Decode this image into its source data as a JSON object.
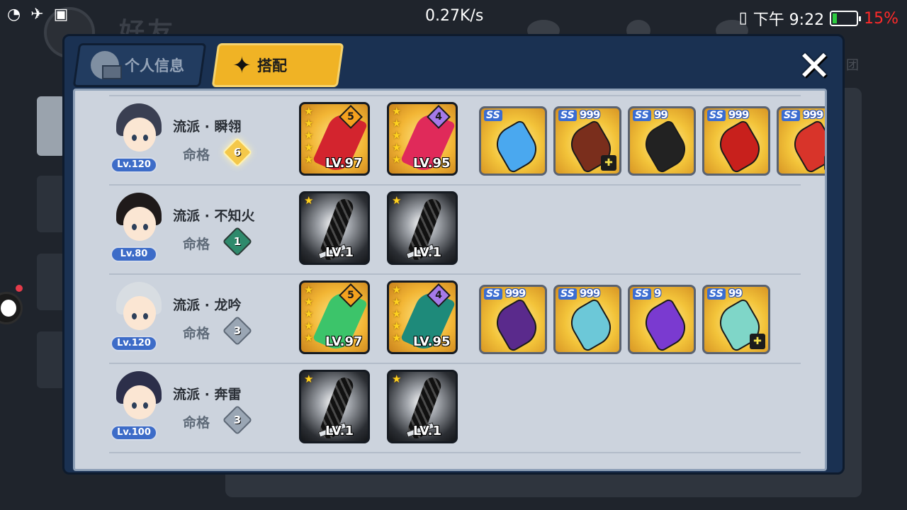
{
  "status_bar": {
    "net_speed": "0.27K/s",
    "time": "下午 9:22",
    "battery_pct": "15%",
    "battery_color": "#ff2a2a"
  },
  "background": {
    "title": "好友",
    "tag": "团"
  },
  "tabs": [
    {
      "label": "个人信息",
      "icon": "person-card-icon",
      "active": false
    },
    {
      "label": "搭配",
      "icon": "shuriken-icon",
      "active": true
    }
  ],
  "fate_label": "命格",
  "rows": [
    {
      "level": "Lv.120",
      "style": "流派 · 瞬翎",
      "fate": "6",
      "fate_style": "gold",
      "hair_color": "#3a3f52",
      "cards": [
        {
          "type": "gold",
          "stars": 5,
          "grade": "5",
          "grade_color": "orange",
          "lv": "LV.97",
          "art_color": "#d3242e"
        },
        {
          "type": "gold",
          "stars": 5,
          "grade": "4",
          "grade_color": "purple",
          "lv": "LV.95",
          "art_color": "#e02a5a"
        }
      ],
      "items": [
        {
          "rank": "SS",
          "marks": "",
          "art_color": "#4aa8ef",
          "corner": false
        },
        {
          "rank": "SS",
          "marks": "999",
          "art_color": "#7a2e1c",
          "corner": true
        },
        {
          "rank": "SS",
          "marks": "99",
          "art_color": "#222222",
          "corner": false
        },
        {
          "rank": "SS",
          "marks": "999",
          "art_color": "#c8201c",
          "corner": false
        },
        {
          "rank": "SS",
          "marks": "999",
          "art_color": "#d8342a",
          "corner": true
        }
      ]
    },
    {
      "level": "Lv.80",
      "style": "流派 · 不知火",
      "fate": "1",
      "fate_style": "teal",
      "hair_color": "#1f1a1a",
      "cards": [
        {
          "type": "dark",
          "stars": 1,
          "grade": "",
          "grade_color": "",
          "lv": "LV.1",
          "art_color": ""
        },
        {
          "type": "dark",
          "stars": 1,
          "grade": "",
          "grade_color": "",
          "lv": "LV.1",
          "art_color": ""
        }
      ],
      "items": []
    },
    {
      "level": "Lv.120",
      "style": "流派 · 龙吟",
      "fate": "3",
      "fate_style": "grey",
      "hair_color": "#d8dde2",
      "cards": [
        {
          "type": "gold",
          "stars": 5,
          "grade": "5",
          "grade_color": "orange",
          "lv": "LV.97",
          "art_color": "#3cc46a"
        },
        {
          "type": "gold",
          "stars": 5,
          "grade": "4",
          "grade_color": "purple",
          "lv": "LV.95",
          "art_color": "#1e8a7a"
        }
      ],
      "items": [
        {
          "rank": "SS",
          "marks": "999",
          "art_color": "#5a2a8c",
          "corner": false
        },
        {
          "rank": "SS",
          "marks": "999",
          "art_color": "#6cc8d8",
          "corner": false
        },
        {
          "rank": "SS",
          "marks": "9",
          "art_color": "#7a3ad0",
          "corner": false
        },
        {
          "rank": "SS",
          "marks": "99",
          "art_color": "#7fd6c8",
          "corner": true
        }
      ]
    },
    {
      "level": "Lv.100",
      "style": "流派 · 奔雷",
      "fate": "3",
      "fate_style": "grey",
      "hair_color": "#2c2f4a",
      "cards": [
        {
          "type": "dark",
          "stars": 1,
          "grade": "",
          "grade_color": "",
          "lv": "LV.1",
          "art_color": ""
        },
        {
          "type": "dark",
          "stars": 1,
          "grade": "",
          "grade_color": "",
          "lv": "LV.1",
          "art_color": ""
        }
      ],
      "items": []
    }
  ],
  "close_icon": "close-x-icon"
}
